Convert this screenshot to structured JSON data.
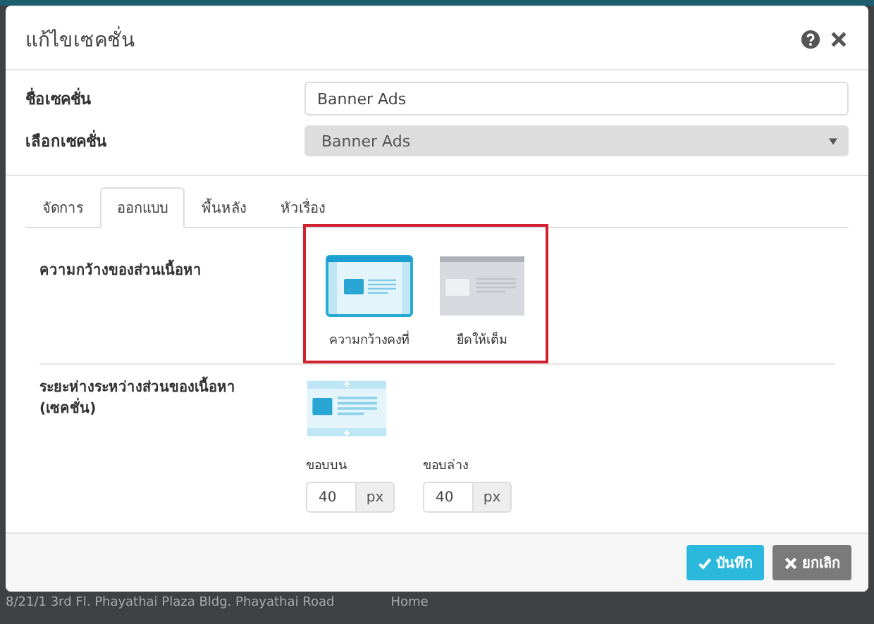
{
  "dialog": {
    "title": "แก้ไขเซคชั่น",
    "fields": [
      {
        "label": "ชื่อเซคชั่น",
        "kind": "input",
        "value": "Banner Ads"
      },
      {
        "label": "เลือกเซคชั่น",
        "kind": "select",
        "value": "Banner Ads"
      }
    ],
    "tabs": [
      {
        "label": "จัดการ",
        "selected": false
      },
      {
        "label": "ออกแบบ",
        "selected": true
      },
      {
        "label": "พื้นหลัง",
        "selected": false
      },
      {
        "label": "หัวเรื่อง",
        "selected": false
      }
    ],
    "content_width": {
      "label": "ความกว้างของส่วนเนื้อหา",
      "options": [
        {
          "label": "ความกว้างคงที่",
          "kind": "fixed",
          "selected": true
        },
        {
          "label": "ยืดให้เต็ม",
          "kind": "full",
          "selected": false
        }
      ]
    },
    "spacing": {
      "label": "ระยะห่างระหว่างส่วนของเนื้อหา (เซคชั่น)",
      "inputs": [
        {
          "label": "ขอบบน",
          "value": "40",
          "unit": "px"
        },
        {
          "label": "ขอบล่าง",
          "value": "40",
          "unit": "px"
        }
      ]
    },
    "buttons": [
      {
        "label": "บันทึก",
        "kind": "save"
      },
      {
        "label": "ยกเลิก",
        "kind": "cancel"
      }
    ]
  },
  "background": {
    "address": "8/21/1 3rd Fl. Phayathai Plaza Bldg. Phayathai Road",
    "link": "Home"
  }
}
